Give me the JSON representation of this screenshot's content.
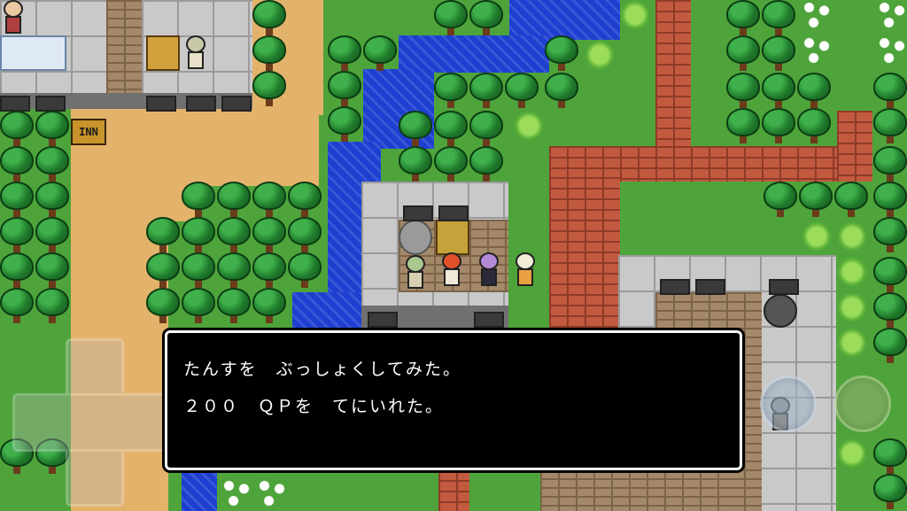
{
  "map": {
    "inn_sign_text": "INN"
  },
  "dialog": {
    "line1": "たんすを　ぶっしょくしてみた。",
    "line2": "２００　ＱＰを　てにいれた。"
  },
  "controls": {
    "dpad_icon": "dpad-icon",
    "action_a_icon": "action-a-icon",
    "action_b_icon": "action-b-icon"
  },
  "colors": {
    "message_bg": "#000000",
    "message_border": "#ffffff",
    "message_text": "#ffffff",
    "water": "#1d3fd0",
    "grass": "#4ea43a",
    "sand": "#e4b36b",
    "brick": "#c25a3f"
  }
}
